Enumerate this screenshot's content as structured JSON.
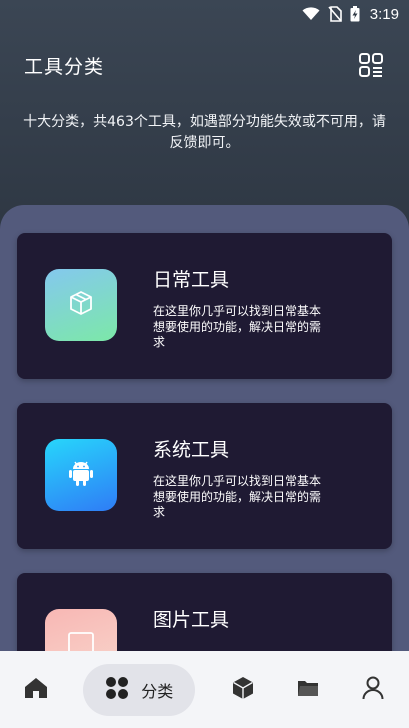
{
  "status": {
    "time": "3:19"
  },
  "header": {
    "title": "工具分类",
    "grid_icon": "grid-list-icon"
  },
  "subtitle": "十大分类，共463个工具，如遇部分功能失效或不可用，请反馈即可。",
  "cards": [
    {
      "title": "日常工具",
      "desc": "在这里你几乎可以找到日常基本想要使用的功能，解决日常的需求",
      "icon": "cube-icon",
      "gradient": [
        "#7fc6ee",
        "#7ee8a6"
      ]
    },
    {
      "title": "系统工具",
      "desc": "在这里你几乎可以找到日常基本想要使用的功能，解决日常的需求",
      "icon": "android-icon",
      "gradient": [
        "#2bc3f6",
        "#2f7cf6"
      ]
    },
    {
      "title": "图片工具",
      "desc": "",
      "icon": "image-icon",
      "gradient": [
        "#f8b9b6",
        "#f7d2c8"
      ]
    }
  ],
  "nav": {
    "home": "home-icon",
    "category_label": "分类",
    "tools": "box-icon",
    "files": "folder-icon",
    "profile": "user-icon"
  }
}
